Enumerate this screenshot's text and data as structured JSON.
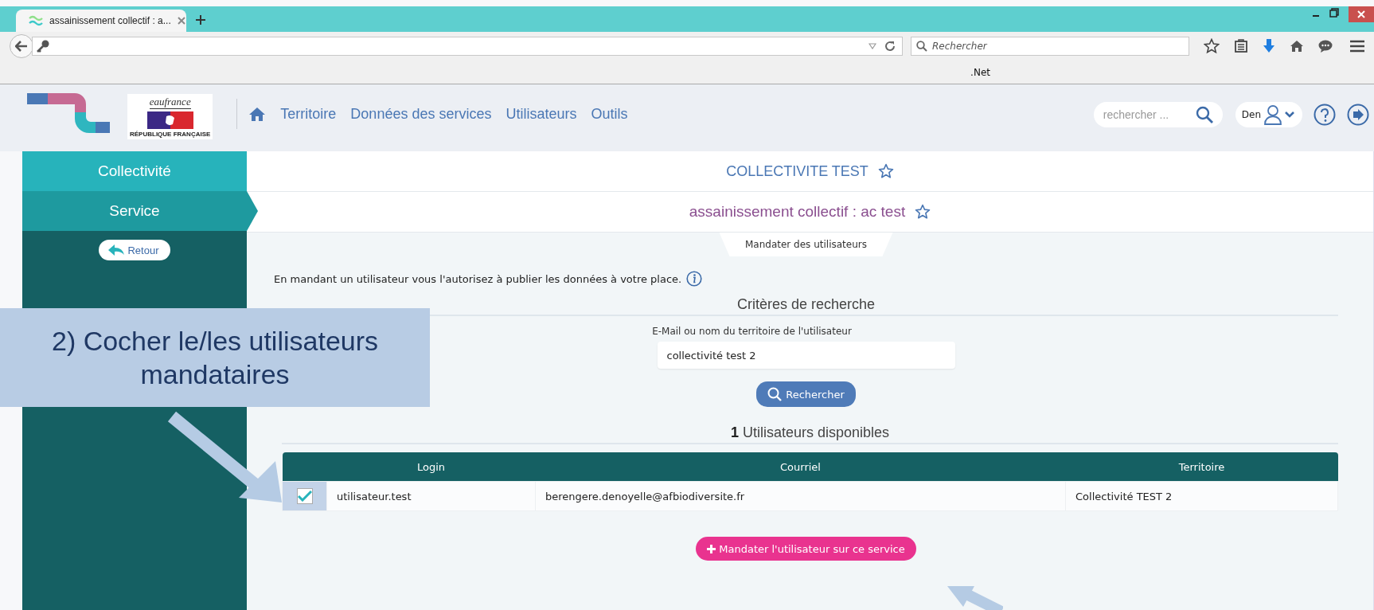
{
  "browser": {
    "tab_title": "assainissement collectif : a...",
    "search_placeholder": "Rechercher",
    "bookmarks": [
      ".Net"
    ]
  },
  "header": {
    "logo_text": "eaufrance",
    "republic_text": "RÉPUBLIQUE FRANÇAISE",
    "nav": [
      "Territoire",
      "Données des services",
      "Utilisateurs",
      "Outils"
    ],
    "search_placeholder": "rechercher ...",
    "user": "Den"
  },
  "sidebar": {
    "items": [
      {
        "label": "Collectivité",
        "selected": false
      },
      {
        "label": "Service",
        "selected": true
      }
    ],
    "back": "Retour"
  },
  "titles": {
    "collectivite": "COLLECTIVITE TEST",
    "service": "assainissement collectif : ac test"
  },
  "section_tab": "Mandater des utilisateurs",
  "intro": "En mandant un utilisateur vous l'autorisez à publier les données à votre place.",
  "search": {
    "heading": "Critères de recherche",
    "label": "E-Mail ou nom du territoire de l'utilisateur",
    "value": "collectivité test 2",
    "button": "Rechercher"
  },
  "results": {
    "heading": "**1** Utilisateurs disponibles",
    "columns": [
      "Login",
      "Courriel",
      "Territoire"
    ],
    "rows": [
      {
        "checked": true,
        "cells": [
          "utilisateur.test",
          "berengere.denoyelle@afbiodiversite.fr",
          "Collectivité TEST 2"
        ]
      }
    ]
  },
  "submit": "Mandater l'utilisateur sur ce service",
  "callout": {
    "lines": [
      "2) Cocher le/les utilisateurs",
      "mandataires"
    ]
  }
}
